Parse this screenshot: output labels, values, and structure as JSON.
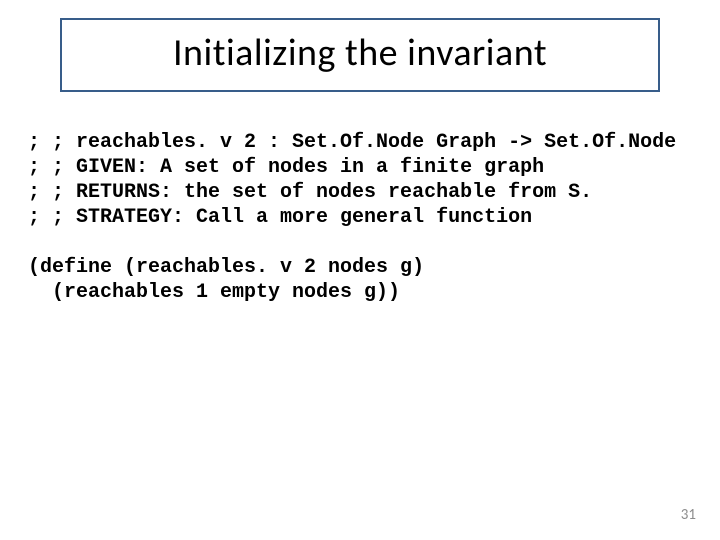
{
  "title": "Initializing the invariant",
  "code_lines": {
    "l1": "; ; reachables. v 2 : Set.Of.Node Graph -> Set.Of.Node",
    "l2": "; ; GIVEN: A set of nodes in a finite graph",
    "l3": "; ; RETURNS: the set of nodes reachable from S.",
    "l4": "; ; STRATEGY: Call a more general function",
    "blank1": "",
    "l5": "(define (reachables. v 2 nodes g)",
    "l6": "  (reachables 1 empty nodes g))"
  },
  "page_number": "31"
}
